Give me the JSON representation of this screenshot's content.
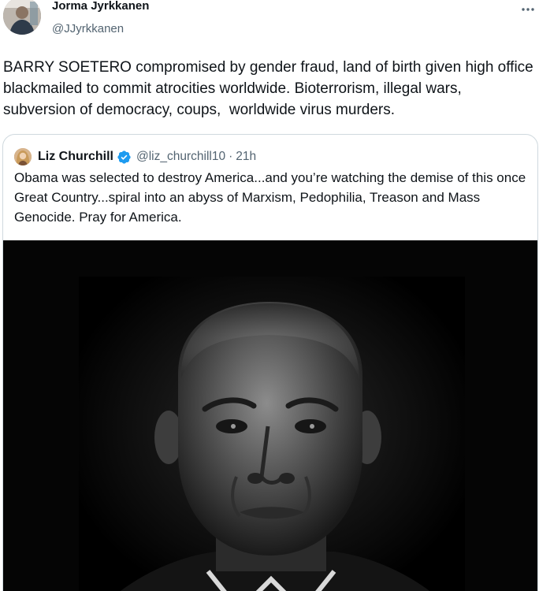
{
  "author": {
    "name": "Jorma Jyrkkanen",
    "handle": "@JJyrkkanen"
  },
  "icons": {
    "more": "more-horizontal-icon",
    "verified": "verified-badge-icon"
  },
  "tweet": {
    "text": "BARRY SOETERO compromised by gender fraud, land of birth given high office blackmailed to commit atrocities worldwide. Bioterrorism, illegal wars, subversion of democracy, coups,  worldwide virus murders."
  },
  "quote": {
    "name": "Liz Churchill",
    "handle": "@liz_churchill10",
    "separator": "·",
    "time": "21h",
    "text": "Obama was selected to destroy America...and you’re watching the demise of this once Great Country...spiral into an abyss of Marxism, Pedophilia, Treason and Mass Genocide. Pray for America."
  },
  "colors": {
    "text": "#0f1419",
    "secondary": "#536471",
    "border": "#cfd9de",
    "verified": "#1d9bf0"
  }
}
